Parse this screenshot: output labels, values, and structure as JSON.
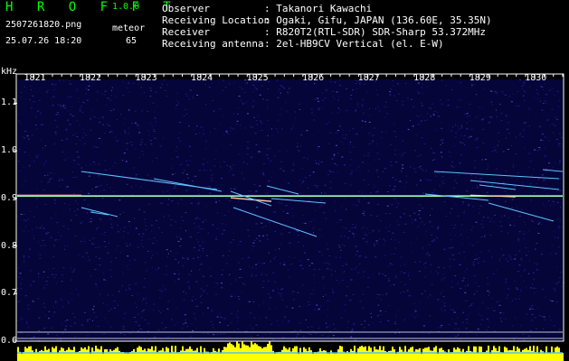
{
  "header": {
    "app_title": "H R O F F T",
    "version": "1.0.0",
    "filename": "2507261820.png",
    "datetime": "25.07.26 18:20",
    "meteor_label": "meteor",
    "meteor_count": "65"
  },
  "info": {
    "rows": [
      {
        "key": "Observer",
        "value": ": Takanori Kawachi"
      },
      {
        "key": "Receiving Location",
        "value": ": Ogaki, Gifu, JAPAN (136.60E, 35.35N)"
      },
      {
        "key": "Receiver",
        "value": ": R820T2(RTL-SDR) SDR-Sharp 53.372MHz"
      },
      {
        "key": "Receiving antenna",
        "value": ": 2el-HB9CV Vertical (el. E-W)"
      }
    ]
  },
  "chart_data": {
    "type": "heatmap",
    "ylabel": "kHz",
    "x_ticks": [
      "1821",
      "1822",
      "1823",
      "1824",
      "1825",
      "1826",
      "1827",
      "1828",
      "1829",
      "1830"
    ],
    "y_ticks": [
      "1.1",
      "1.0",
      "0.9",
      "0.8",
      "0.7",
      "0.6"
    ],
    "ylim": [
      0.6,
      1.15
    ],
    "xlim": [
      1820.7,
      1830.5
    ],
    "carrier_khz": 0.905
  },
  "colors": {
    "background": "#000000",
    "noise": "#1a1a7a",
    "carrier": "#a0ffb0",
    "echo": "#60c0ff",
    "histogram": "#ffff00",
    "text": "#ffffff",
    "title": "#00ff00"
  }
}
